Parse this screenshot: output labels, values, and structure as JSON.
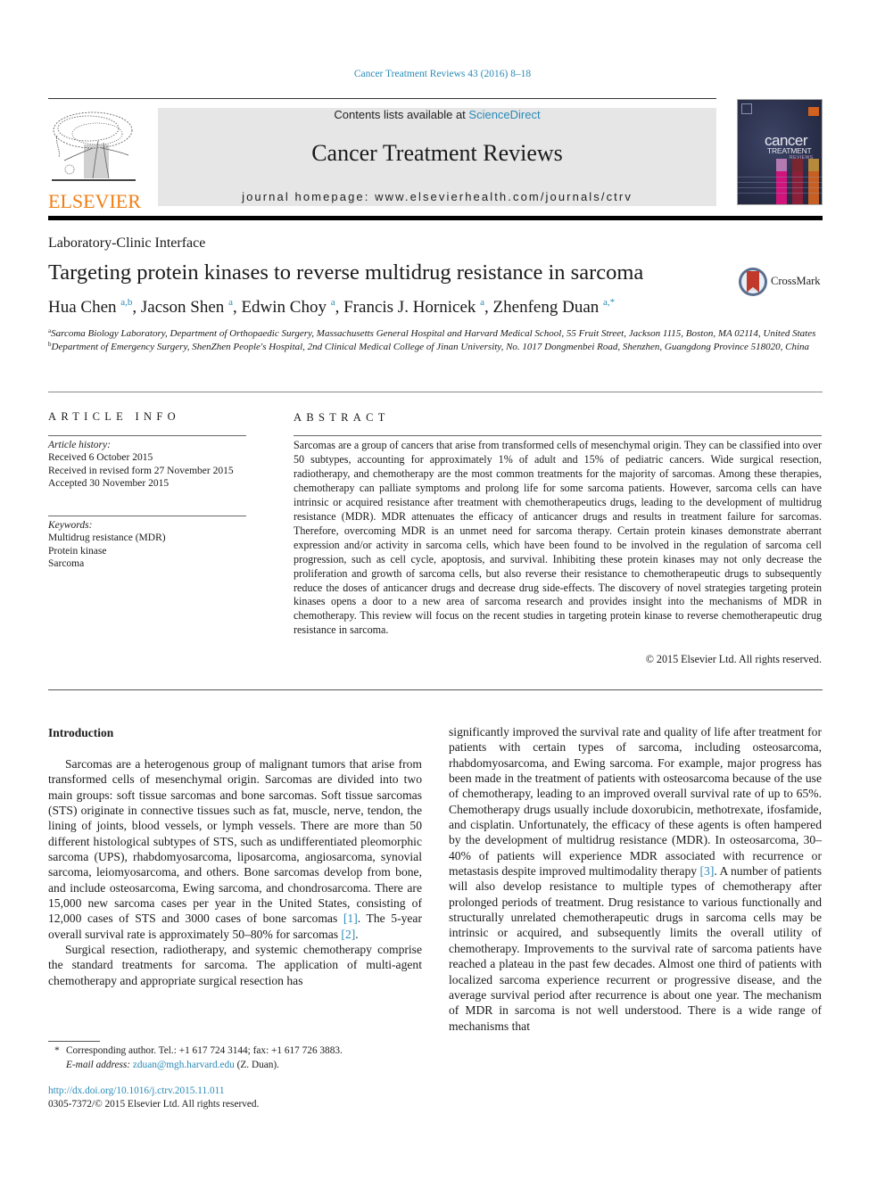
{
  "header": {
    "journal_ref": "Cancer Treatment Reviews 43 (2016) 8–18",
    "contents_prefix": "Contents lists available at ",
    "contents_link": "ScienceDirect",
    "journal_title": "Cancer Treatment Reviews",
    "homepage": "journal homepage: www.elsevierhealth.com/journals/ctrv",
    "publisher_logo_text": "ELSEVIER",
    "cover": {
      "word1": "cancer",
      "word2": "TREATMENT",
      "word3": "REVIEWS"
    },
    "colors": {
      "link": "#2a8ab7",
      "elsevier_orange": "#f07f12",
      "masthead_bg": "#e6e6e6"
    }
  },
  "article": {
    "section": "Laboratory-Clinic Interface",
    "title": "Targeting protein kinases to reverse multidrug resistance in sarcoma",
    "crossmark_label": "CrossMark",
    "authors": [
      {
        "name": "Hua Chen",
        "sup": "a,b",
        "sep": ", "
      },
      {
        "name": "Jacson Shen",
        "sup": "a",
        "sep": ", "
      },
      {
        "name": "Edwin Choy",
        "sup": "a",
        "sep": ", "
      },
      {
        "name": "Francis J. Hornicek",
        "sup": "a",
        "sep": ", "
      },
      {
        "name": "Zhenfeng Duan",
        "sup": "a,*",
        "sep": ""
      }
    ],
    "affiliations": [
      {
        "mark": "a",
        "text": "Sarcoma Biology Laboratory, Department of Orthopaedic Surgery, Massachusetts General Hospital and Harvard Medical School, 55 Fruit Street, Jackson 1115, Boston, MA 02114, United States"
      },
      {
        "mark": "b",
        "text": "Department of Emergency Surgery, ShenZhen People's Hospital, 2nd Clinical Medical College of Jinan University, No. 1017 Dongmenbei Road, Shenzhen, Guangdong Province 518020, China"
      }
    ]
  },
  "article_info": {
    "heading": "ARTICLE INFO",
    "history_label": "Article history:",
    "history": [
      "Received 6 October 2015",
      "Received in revised form 27 November 2015",
      "Accepted 30 November 2015"
    ],
    "keywords_label": "Keywords:",
    "keywords": [
      "Multidrug resistance (MDR)",
      "Protein kinase",
      "Sarcoma"
    ]
  },
  "abstract": {
    "heading": "ABSTRACT",
    "text": "Sarcomas are a group of cancers that arise from transformed cells of mesenchymal origin. They can be classified into over 50 subtypes, accounting for approximately 1% of adult and 15% of pediatric cancers. Wide surgical resection, radiotherapy, and chemotherapy are the most common treatments for the majority of sarcomas. Among these therapies, chemotherapy can palliate symptoms and prolong life for some sarcoma patients. However, sarcoma cells can have intrinsic or acquired resistance after treat­ment with chemotherapeutics drugs, leading to the development of multidrug resistance (MDR). MDR attenuates the efficacy of anticancer drugs and results in treatment failure for sarcomas. Therefore, over­coming MDR is an unmet need for sarcoma therapy. Certain protein kinases demonstrate aberrant expression and/or activity in sarcoma cells, which have been found to be involved in the regulation of sarcoma cell progression, such as cell cycle, apoptosis, and survival. Inhibiting these protein kinases may not only decrease the proliferation and growth of sarcoma cells, but also reverse their resistance to chemotherapeutic drugs to subsequently reduce the doses of anticancer drugs and decrease drug side-effects. The discovery of novel strategies targeting protein kinases opens a door to a new area of sar­coma research and provides insight into the mechanisms of MDR in chemotherapy. This review will focus on the recent studies in targeting protein kinase to reverse chemotherapeutic drug resistance in sarcoma.",
    "copyright": "© 2015 Elsevier Ltd. All rights reserved."
  },
  "body": {
    "intro_heading": "Introduction",
    "left_p1": {
      "before_ref1": "Sarcomas are a heterogenous group of malignant tumors that arise from transformed cells of mesenchymal origin. Sarcomas are divided into two main groups: soft tissue sarcomas and bone sarcomas. Soft tissue sarcomas (STS) originate in connective tissues such as fat, muscle, nerve, tendon, the lining of joints, blood ves­sels, or lymph vessels. There are more than 50 different histological subtypes of STS, such as undifferentiated pleomorphic sarcoma (UPS), rhabdomyosarcoma, liposarcoma, angiosarcoma, synovial sarcoma, leiomyosarcoma, and others. Bone sarcomas develop from bone, and include osteosarcoma, Ewing sarcoma, and chon­drosarcoma. There are 15,000 new sarcoma cases per year in the United States, consisting of 12,000 cases of STS and 3000 cases of bone sarcomas ",
      "ref1": "[1]",
      "between": ". The 5-year overall survival rate is approxi­mately 50–80% for sarcomas ",
      "ref2": "[2]",
      "after": "."
    },
    "left_p2": "Surgical resection, radiotherapy, and systemic chemotherapy comprise the standard treatments for sarcoma. The application of multi-agent chemotherapy and appropriate surgical resection has",
    "right_p": {
      "before_ref3": "significantly improved the survival rate and quality of life after treatment for patients with certain types of sarcoma, including osteosarcoma, rhabdomyosarcoma, and Ewing sarcoma. For exam­ple, major progress has been made in the treatment of patients with osteosarcoma because of the use of chemotherapy, leading to an improved overall survival rate of up to 65%. Chemotherapy drugs usually include doxorubicin, methotrexate, ifosfamide, and cisplatin. Unfortunately, the efficacy of these agents is often ham­pered by the development of multidrug resistance (MDR). In osteosarcoma, 30–40% of patients will experience MDR associated with recurrence or metastasis despite improved multimodality therapy ",
      "ref3": "[3]",
      "after": ". A number of patients will also develop resistance to multiple types of chemotherapy after prolonged periods of treat­ment. Drug resistance to various functionally and structurally unrelated chemotherapeutic drugs in sarcoma cells may be intrin­sic or acquired, and subsequently limits the overall utility of chemotherapy. Improvements to the survival rate of sarcoma patients have reached a plateau in the past few decades. Almost one third of patients with localized sarcoma experience recurrent or progressive disease, and the average survival period after recur­rence is about one year. The mechanism of MDR in sarcoma is not well understood. There is a wide range of mechanisms that"
    }
  },
  "footnote": {
    "star": "*",
    "corresponding": "Corresponding author. Tel.: +1 617 724 3144; fax: +1 617 726 3883.",
    "email_label": "E-mail address:",
    "email": "zduan@mgh.harvard.edu",
    "email_suffix": " (Z. Duan).",
    "doi": "http://dx.doi.org/10.1016/j.ctrv.2015.11.011",
    "issn_copyright": "0305-7372/© 2015 Elsevier Ltd. All rights reserved."
  }
}
